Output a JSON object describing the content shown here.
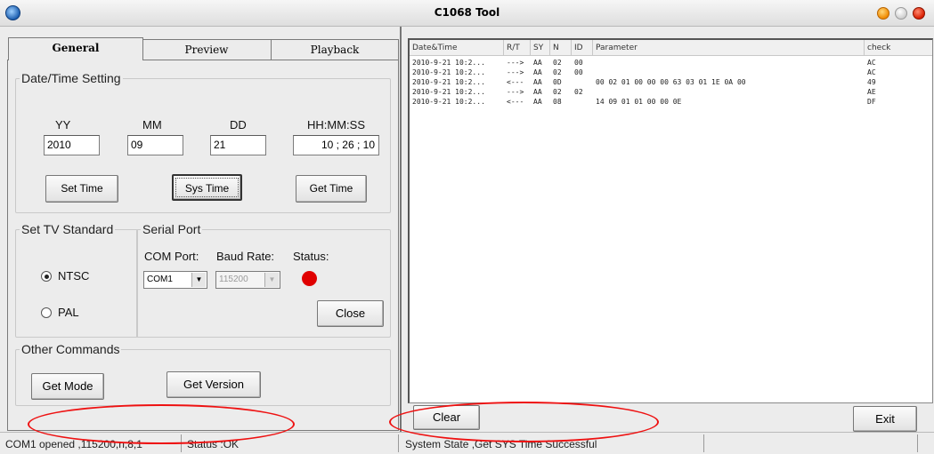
{
  "window": {
    "title": "C1068 Tool"
  },
  "tabs": [
    {
      "label": "General"
    },
    {
      "label": "Preview"
    },
    {
      "label": "Playback"
    }
  ],
  "datetime": {
    "group_label": "Date/Time Setting",
    "yy_label": "YY",
    "mm_label": "MM",
    "dd_label": "DD",
    "hms_label": "HH:MM:SS",
    "yy_value": "2010",
    "mm_value": "09",
    "dd_value": "21",
    "hms_value": "10 ; 26 ; 10",
    "set_time": "Set Time",
    "sys_time": "Sys Time",
    "get_time": "Get Time"
  },
  "tv": {
    "group_label": "Set TV Standard",
    "ntsc": "NTSC",
    "pal": "PAL",
    "selected": "NTSC"
  },
  "serial": {
    "group_label": "Serial Port",
    "com_label": "COM Port:",
    "baud_label": "Baud Rate:",
    "status_label": "Status:",
    "com_value": "COM1",
    "baud_value": "115200",
    "status_color": "#e00000",
    "close": "Close"
  },
  "other": {
    "group_label": "Other Commands",
    "get_mode": "Get Mode",
    "get_version": "Get Version"
  },
  "log": {
    "headers": [
      "Date&Time",
      "R/T",
      "SY",
      "N",
      "ID",
      "Parameter",
      "check"
    ],
    "rows": [
      [
        "2010-9-21  10:2...",
        "--->",
        "AA",
        "02",
        "00",
        "",
        "AC"
      ],
      [
        "2010-9-21  10:2...",
        "--->",
        "AA",
        "02",
        "00",
        "",
        "AC"
      ],
      [
        "2010-9-21  10:2...",
        "<---",
        "AA",
        "0D",
        "",
        "00 02 01 00 00 00 63 03 01 1E 0A 00",
        "49"
      ],
      [
        "2010-9-21  10:2...",
        "--->",
        "AA",
        "02",
        "02",
        "",
        "AE"
      ],
      [
        "2010-9-21  10:2...",
        "<---",
        "AA",
        "08",
        "",
        "14 09 01 01 00 00 0E",
        "DF"
      ]
    ]
  },
  "bottom": {
    "clear": "Clear",
    "exit": "Exit"
  },
  "status": {
    "port": "COM1 opened ,115200,n,8,1",
    "state": "Status :OK",
    "system": "System State ,Get SYS Time Successful"
  },
  "colors": {
    "annotation": "#e01010",
    "window_bg": "#ececec"
  }
}
